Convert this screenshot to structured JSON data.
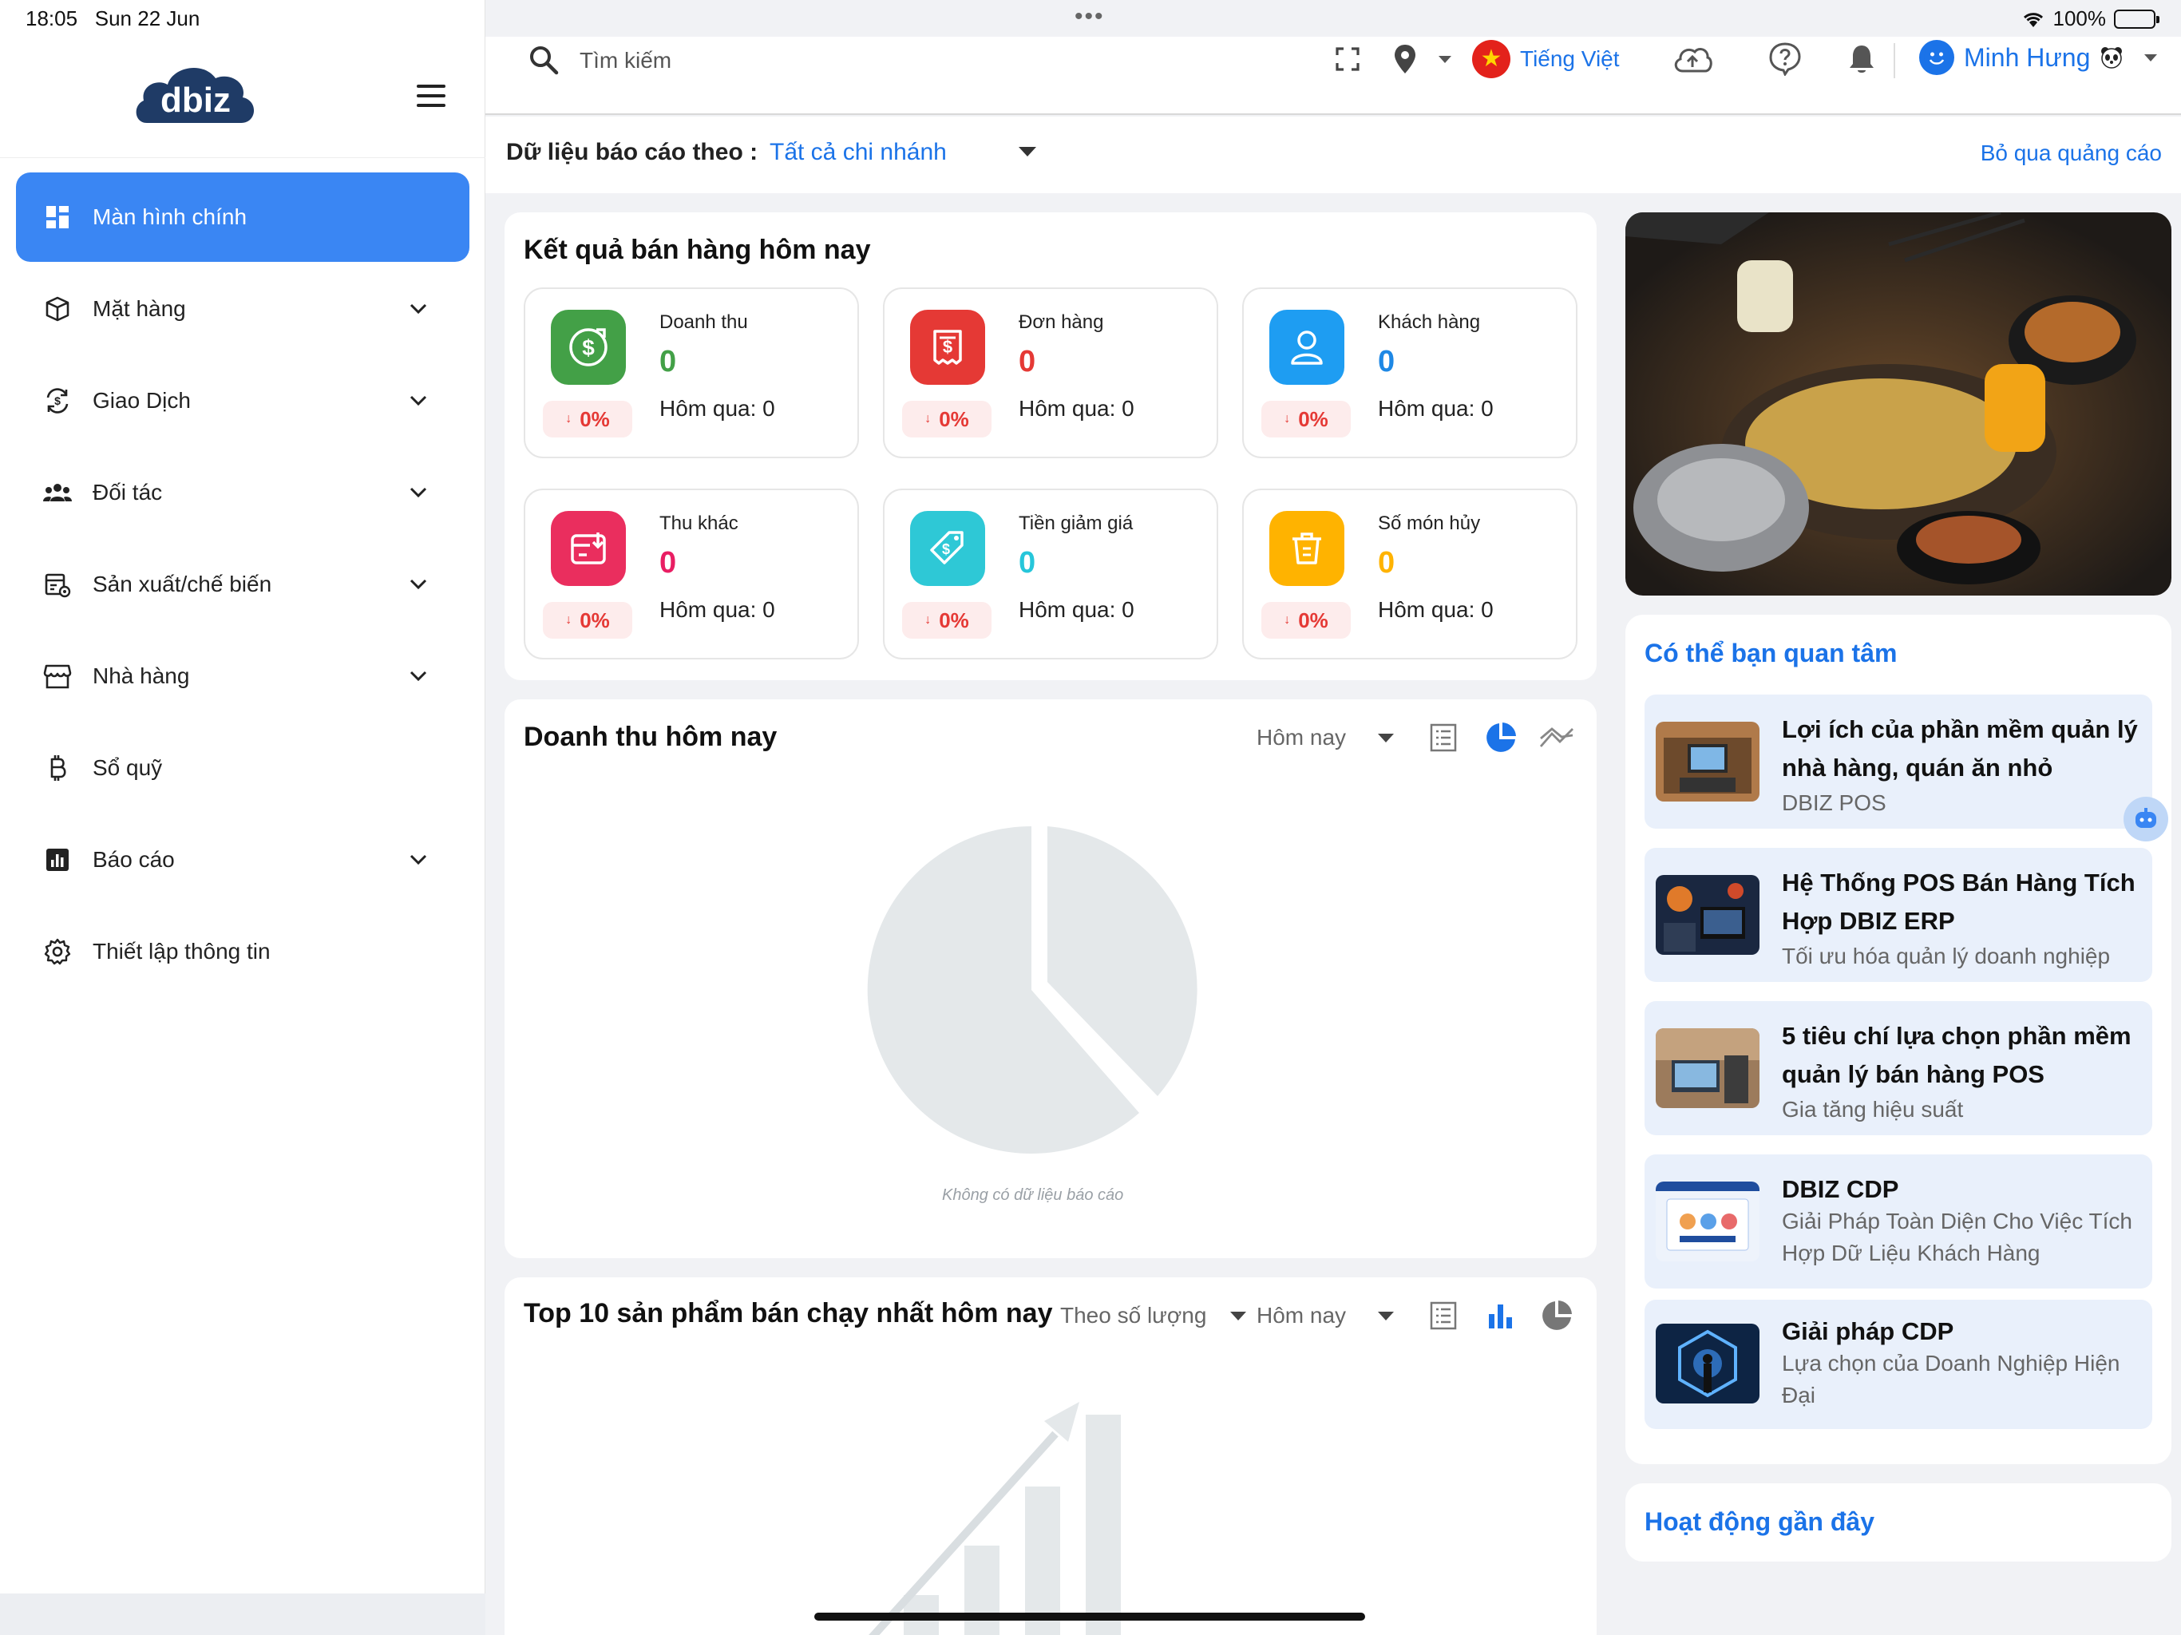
{
  "status_bar": {
    "time": "18:05",
    "date": "Sun 22 Jun",
    "battery": "100%"
  },
  "brand": {
    "logo_text": "dbiz"
  },
  "sidebar": {
    "items": [
      {
        "label": "Màn hình chính",
        "icon": "dashboard-icon",
        "active": true,
        "expandable": false
      },
      {
        "label": "Mặt hàng",
        "icon": "box-icon",
        "expandable": true
      },
      {
        "label": "Giao Dịch",
        "icon": "transaction-icon",
        "expandable": true
      },
      {
        "label": "Đối tác",
        "icon": "partners-icon",
        "expandable": true
      },
      {
        "label": "Sản xuất/chế biến",
        "icon": "production-icon",
        "expandable": true
      },
      {
        "label": "Nhà hàng",
        "icon": "store-icon",
        "expandable": true
      },
      {
        "label": "Sổ quỹ",
        "icon": "bitcoin-icon",
        "expandable": false
      },
      {
        "label": "Báo cáo",
        "icon": "report-icon",
        "expandable": true
      },
      {
        "label": "Thiết lập thông tin",
        "icon": "settings-icon",
        "expandable": false
      }
    ]
  },
  "topbar": {
    "search_placeholder": "Tìm kiếm",
    "language": "Tiếng Việt",
    "user_name": "Minh Hưng"
  },
  "filter": {
    "label": "Dữ liệu báo cáo theo :",
    "value": "Tất cả chi nhánh",
    "skip_ads": "Bỏ qua quảng cáo"
  },
  "sales_today": {
    "title": "Kết quả bán hàng hôm nay",
    "stats": [
      {
        "label": "Doanh thu",
        "value": "0",
        "yesterday": "Hôm qua: 0",
        "change": "0%",
        "color": "#43a047",
        "icon": "revenue-icon"
      },
      {
        "label": "Đơn hàng",
        "value": "0",
        "yesterday": "Hôm qua: 0",
        "change": "0%",
        "color": "#e53935",
        "icon": "order-icon"
      },
      {
        "label": "Khách hàng",
        "value": "0",
        "yesterday": "Hôm qua: 0",
        "change": "0%",
        "color": "#1e88e5",
        "icon": "customer-icon"
      },
      {
        "label": "Thu khác",
        "value": "0",
        "yesterday": "Hôm qua: 0",
        "change": "0%",
        "color": "#e91e63",
        "icon": "other-income-icon"
      },
      {
        "label": "Tiền giảm giá",
        "value": "0",
        "yesterday": "Hôm qua: 0",
        "change": "0%",
        "color": "#26c6da",
        "icon": "discount-icon"
      },
      {
        "label": "Số món hủy",
        "value": "0",
        "yesterday": "Hôm qua: 0",
        "change": "0%",
        "color": "#ffb300",
        "icon": "cancel-icon"
      }
    ]
  },
  "revenue_today": {
    "title": "Doanh thu hôm nay",
    "period": "Hôm nay",
    "empty_text": "Không có dữ liệu báo cáo"
  },
  "top_products": {
    "title": "Top 10 sản phẩm bán chạy nhất hôm nay",
    "sort_by": "Theo số lượng",
    "period": "Hôm nay"
  },
  "interest": {
    "title": "Có thể bạn quan tâm",
    "items": [
      {
        "title": "Lợi ích của phần mềm quản lý nhà hàng, quán ăn nhỏ",
        "subtitle": "DBIZ POS"
      },
      {
        "title": "Hệ Thống POS Bán Hàng Tích Hợp DBIZ ERP",
        "subtitle": "Tối ưu hóa quản lý doanh nghiệp"
      },
      {
        "title": "5 tiêu chí lựa chọn phần mềm quản lý bán hàng POS",
        "subtitle": "Gia tăng hiệu suất"
      },
      {
        "title": "DBIZ CDP",
        "subtitle": "Giải Pháp Toàn Diện Cho Việc Tích Hợp Dữ Liệu Khách Hàng"
      },
      {
        "title": "Giải pháp CDP",
        "subtitle": "Lựa chọn của Doanh Nghiệp Hiện Đại"
      }
    ]
  },
  "activity": {
    "title": "Hoạt động gần đây"
  },
  "colors": {
    "accent": "#1b73e8",
    "active_nav": "#3a86f3",
    "negative": "#e53935"
  }
}
